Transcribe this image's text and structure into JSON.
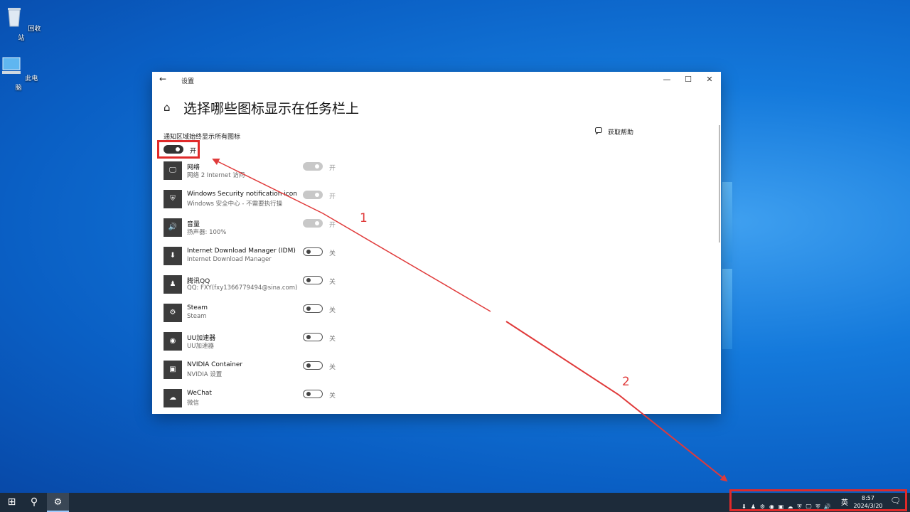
{
  "desktop": {
    "icons": [
      {
        "label": "回收站",
        "icon": "recycle-bin-icon"
      },
      {
        "label": "此电脑",
        "icon": "computer-icon"
      }
    ]
  },
  "window": {
    "app_title": "设置",
    "back_icon": "←",
    "controls": {
      "minimize": "—",
      "maximize": "☐",
      "close": "✕"
    },
    "home_icon": "⌂",
    "page_title": "选择哪些图标显示在任务栏上",
    "help": {
      "icon": "chat-help-icon",
      "label": "获取帮助"
    },
    "master_toggle": {
      "label": "通知区域始终显示所有图标",
      "state": "开",
      "on": true
    },
    "items": [
      {
        "name": "网络",
        "sub": "网络 2 Internet 访问",
        "state": "开",
        "icon": "network-icon",
        "glyph": "🖵"
      },
      {
        "name": "Windows Security notification icon",
        "sub": "Windows 安全中心 - 不需要执行操",
        "state": "开",
        "icon": "shield-icon",
        "glyph": "⛨"
      },
      {
        "name": "音量",
        "sub": "扬声器: 100%",
        "state": "开",
        "icon": "speaker-icon",
        "glyph": "🔊"
      },
      {
        "name": "Internet Download Manager (IDM)",
        "sub": "Internet Download Manager",
        "state": "关",
        "icon": "idm-icon",
        "glyph": "⬇"
      },
      {
        "name": "腾讯QQ",
        "sub": "QQ: FXY(fxy1366779494@sina.com)",
        "state": "关",
        "icon": "qq-penguin-icon",
        "glyph": "♟"
      },
      {
        "name": "Steam",
        "sub": "Steam",
        "state": "关",
        "icon": "steam-icon",
        "glyph": "⚙"
      },
      {
        "name": "UU加速器",
        "sub": "UU加速器",
        "state": "关",
        "icon": "uu-accelerator-icon",
        "glyph": "◉"
      },
      {
        "name": "NVIDIA Container",
        "sub": "NVIDIA 设置",
        "state": "关",
        "icon": "nvidia-icon",
        "glyph": "▣"
      },
      {
        "name": "WeChat",
        "sub": "微信",
        "state": "关",
        "icon": "wechat-icon",
        "glyph": "☁"
      }
    ]
  },
  "annotations": {
    "label1": "1",
    "label2": "2",
    "color": "#e03a3a"
  },
  "taskbar": {
    "start_icon": "⊞",
    "search_icon": "⚲",
    "settings_icon": "⚙",
    "tray_glyphs": [
      "⬇",
      "♟",
      "⚙",
      "◉",
      "▣",
      "☁",
      "⛨",
      "🖵",
      "⛨",
      "🔊"
    ],
    "ime": "英",
    "time": "8:57",
    "date": "2024/3/20",
    "notification_icon": "🗨"
  }
}
